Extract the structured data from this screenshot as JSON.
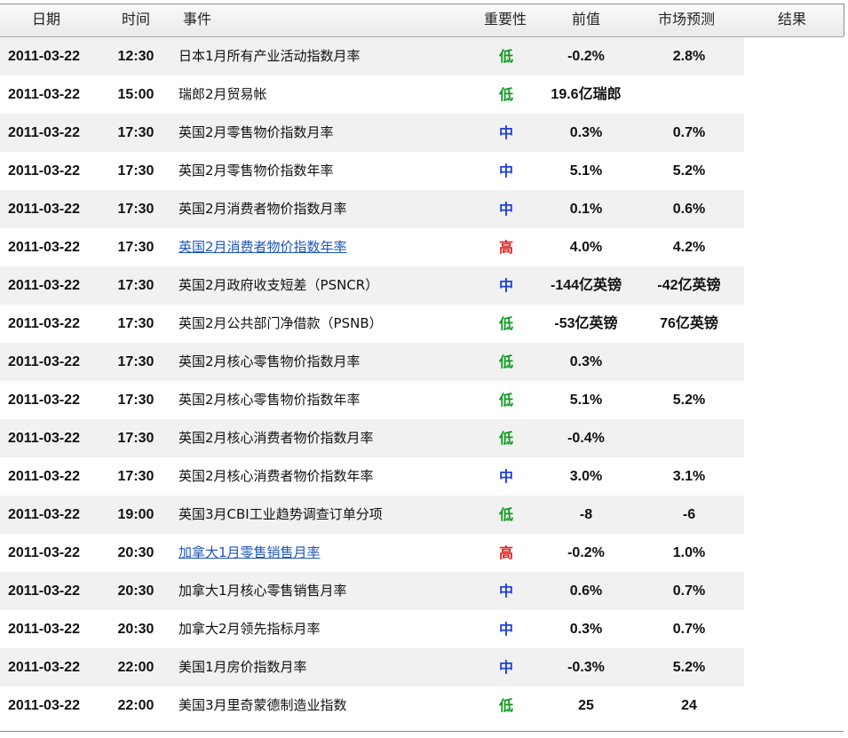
{
  "header": {
    "date": "日期",
    "time": "时间",
    "event": "事件",
    "importance": "重要性",
    "previous": "前值",
    "forecast": "市场预测",
    "result": "结果"
  },
  "colors": {
    "low": "#119a22",
    "medium": "#1f3fd6",
    "high": "#e41e1e",
    "link": "#1f56b8"
  },
  "rows": [
    {
      "date": "2011-03-22",
      "time": "12:30",
      "event": "日本1月所有产业活动指数月率",
      "importance": "低",
      "level": "low",
      "previous": "-0.2%",
      "forecast": "2.8%",
      "result": "",
      "link": false
    },
    {
      "date": "2011-03-22",
      "time": "15:00",
      "event": "瑞郎2月贸易帐",
      "importance": "低",
      "level": "low",
      "previous": "19.6亿瑞郎",
      "forecast": "",
      "result": "",
      "link": false
    },
    {
      "date": "2011-03-22",
      "time": "17:30",
      "event": "英国2月零售物价指数月率",
      "importance": "中",
      "level": "mid",
      "previous": "0.3%",
      "forecast": "0.7%",
      "result": "",
      "link": false
    },
    {
      "date": "2011-03-22",
      "time": "17:30",
      "event": "英国2月零售物价指数年率",
      "importance": "中",
      "level": "mid",
      "previous": "5.1%",
      "forecast": "5.2%",
      "result": "",
      "link": false
    },
    {
      "date": "2011-03-22",
      "time": "17:30",
      "event": "英国2月消费者物价指数月率",
      "importance": "中",
      "level": "mid",
      "previous": "0.1%",
      "forecast": "0.6%",
      "result": "",
      "link": false
    },
    {
      "date": "2011-03-22",
      "time": "17:30",
      "event": "英国2月消费者物价指数年率",
      "importance": "高",
      "level": "high",
      "previous": "4.0%",
      "forecast": "4.2%",
      "result": "",
      "link": true
    },
    {
      "date": "2011-03-22",
      "time": "17:30",
      "event": "英国2月政府收支短差（PSNCR）",
      "importance": "中",
      "level": "mid",
      "previous": "-144亿英镑",
      "forecast": "-42亿英镑",
      "result": "",
      "link": false
    },
    {
      "date": "2011-03-22",
      "time": "17:30",
      "event": "英国2月公共部门净借款（PSNB）",
      "importance": "低",
      "level": "low",
      "previous": "-53亿英镑",
      "forecast": "76亿英镑",
      "result": "",
      "link": false
    },
    {
      "date": "2011-03-22",
      "time": "17:30",
      "event": "英国2月核心零售物价指数月率",
      "importance": "低",
      "level": "low",
      "previous": "0.3%",
      "forecast": "",
      "result": "",
      "link": false
    },
    {
      "date": "2011-03-22",
      "time": "17:30",
      "event": "英国2月核心零售物价指数年率",
      "importance": "低",
      "level": "low",
      "previous": "5.1%",
      "forecast": "5.2%",
      "result": "",
      "link": false
    },
    {
      "date": "2011-03-22",
      "time": "17:30",
      "event": "英国2月核心消费者物价指数月率",
      "importance": "低",
      "level": "low",
      "previous": "-0.4%",
      "forecast": "",
      "result": "",
      "link": false
    },
    {
      "date": "2011-03-22",
      "time": "17:30",
      "event": "英国2月核心消费者物价指数年率",
      "importance": "中",
      "level": "mid",
      "previous": "3.0%",
      "forecast": "3.1%",
      "result": "",
      "link": false
    },
    {
      "date": "2011-03-22",
      "time": "19:00",
      "event": "英国3月CBI工业趋势调查订单分项",
      "importance": "低",
      "level": "low",
      "previous": "-8",
      "forecast": "-6",
      "result": "",
      "link": false
    },
    {
      "date": "2011-03-22",
      "time": "20:30",
      "event": "加拿大1月零售销售月率",
      "importance": "高",
      "level": "high",
      "previous": "-0.2%",
      "forecast": "1.0%",
      "result": "",
      "link": true
    },
    {
      "date": "2011-03-22",
      "time": "20:30",
      "event": "加拿大1月核心零售销售月率",
      "importance": "中",
      "level": "mid",
      "previous": "0.6%",
      "forecast": "0.7%",
      "result": "",
      "link": false
    },
    {
      "date": "2011-03-22",
      "time": "20:30",
      "event": "加拿大2月领先指标月率",
      "importance": "中",
      "level": "mid",
      "previous": "0.3%",
      "forecast": "0.7%",
      "result": "",
      "link": false
    },
    {
      "date": "2011-03-22",
      "time": "22:00",
      "event": "美国1月房价指数月率",
      "importance": "中",
      "level": "mid",
      "previous": "-0.3%",
      "forecast": "5.2%",
      "result": "",
      "link": false
    },
    {
      "date": "2011-03-22",
      "time": "22:00",
      "event": "美国3月里奇蒙德制造业指数",
      "importance": "低",
      "level": "low",
      "previous": "25",
      "forecast": "24",
      "result": "",
      "link": false
    }
  ]
}
